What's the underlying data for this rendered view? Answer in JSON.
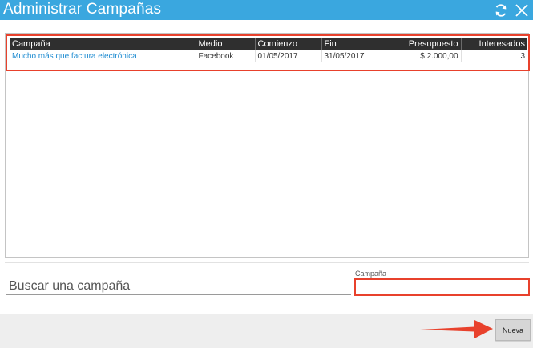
{
  "window": {
    "title": "Administrar Campañas",
    "icons": [
      "refresh-icon",
      "close-icon"
    ]
  },
  "table": {
    "columns": [
      "Campaña",
      "Medio",
      "Comienzo",
      "Fin",
      "Presupuesto",
      "Interesados"
    ],
    "rows": [
      [
        "Mucho más que factura electrónica",
        "Facebook",
        "01/05/2017",
        "31/05/2017",
        "$ 2.000,00",
        "3"
      ]
    ]
  },
  "search": {
    "label": "Buscar una campaña",
    "campaign_label": "Campaña",
    "campaign_value": ""
  },
  "footer": {
    "new_label": "Nueva"
  },
  "colors": {
    "titlebar": "#3aa7df",
    "highlight": "#e8412c",
    "link": "#1d8bd1",
    "header": "#2f2f2f"
  }
}
